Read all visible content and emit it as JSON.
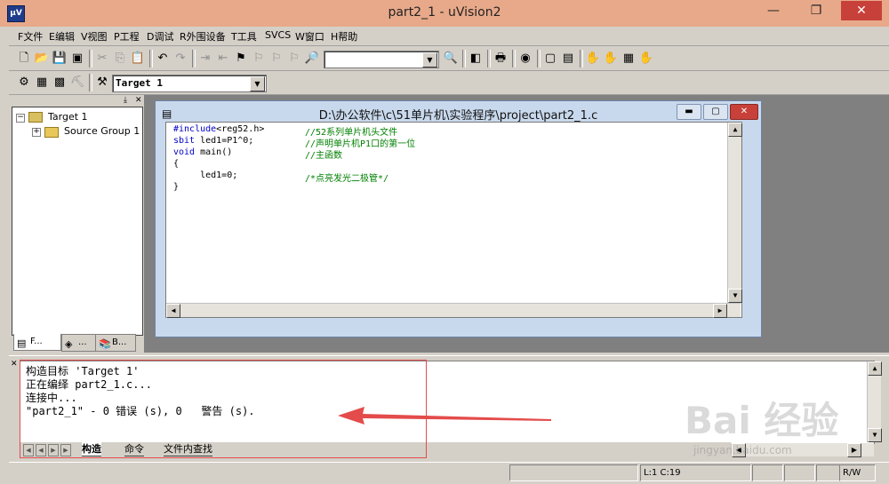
{
  "window": {
    "title": "part2_1  - uVision2",
    "icon_text": "μV"
  },
  "menu": [
    "F文件",
    "E编辑",
    "V视图",
    "P工程",
    "D调试",
    "R外围设备",
    "T工具",
    "SVCS",
    "W窗口",
    "H帮助"
  ],
  "toolbar2": {
    "target": "Target 1"
  },
  "project_tree": {
    "root": "Target 1",
    "group": "Source Group 1"
  },
  "left_tabs": [
    "F...",
    "...",
    "B..."
  ],
  "editor": {
    "title": "D:\\办公软件\\c\\51单片机\\实验程序\\project\\part2_1.c",
    "lines": [
      {
        "kw": "#include",
        "text": "<reg52.h>",
        "comment": "//52系列单片机头文件"
      },
      {
        "kw": "sbit",
        "text": " led1=P1^0;",
        "comment": "//声明单片机P1口的第一位"
      },
      {
        "kw": "void",
        "text": " main()",
        "comment": "//主函数"
      },
      {
        "kw": "",
        "text": "{",
        "comment": ""
      },
      {
        "kw": "",
        "text": "     led1=0;",
        "comment": "/*点亮发光二极管*/"
      },
      {
        "kw": "",
        "text": "}",
        "comment": ""
      }
    ]
  },
  "output": {
    "lines": [
      "构造目标 'Target 1'",
      "正在编绎 part2_1.c...",
      "连接中...",
      "\"part2_1\" - 0 错误 (s), 0   警告 (s)."
    ],
    "tabs": [
      "构造",
      "命令",
      "文件内查找"
    ]
  },
  "status": {
    "position": "L:1 C:19",
    "mode": "R/W"
  },
  "watermark": {
    "brand": "Bai 经验",
    "url": "jingyan.baidu.com"
  },
  "colors": {
    "titlebar": "#e8a98a",
    "keyword": "#0000c8",
    "comment": "#008000",
    "annotation": "#e44b4b",
    "close": "#c7413a"
  }
}
